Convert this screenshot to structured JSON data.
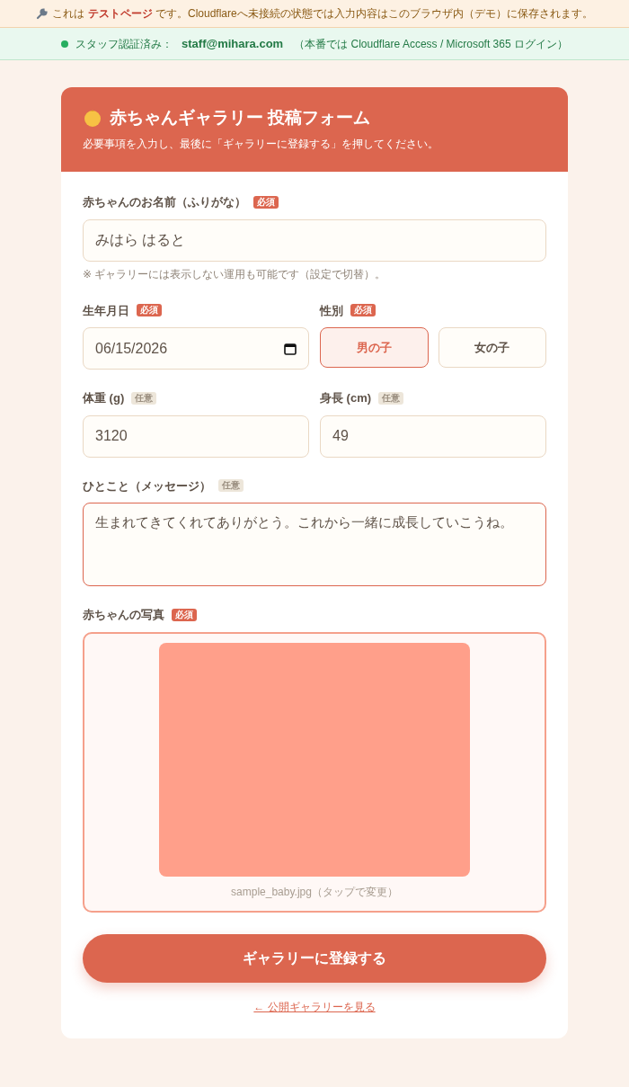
{
  "notice": {
    "text": "これは **テストページ** です。Cloudflareへ未接続の状態では入力内容はこのブラウザ内（デモ）に保存されます。"
  },
  "auth": {
    "color": "#27ae60",
    "label": "スタッフ認証済み：",
    "email": "staff@mihara.com",
    "note": "（本番では Cloudflare Access / Microsoft 365 ログイン）"
  },
  "form": {
    "title": "赤ちゃんギャラリー 投稿フォーム",
    "subtitle": "必要事項を入力し、最後に「ギャラリーに登録する」を押してください。",
    "fields": [
      {
        "kind": "text",
        "label": "赤ちゃんのお名前（ふりがな）",
        "badge": {
          "text": "必須",
          "required": true
        },
        "value": "みはら はると",
        "hint": "※ ギャラリーには表示しない運用も可能です（設定で切替）。"
      },
      {
        "kind": "row",
        "items": [
          {
            "kind": "date",
            "label": "生年月日",
            "badge": {
              "text": "必須",
              "required": true
            },
            "value": "06/15/2026"
          },
          {
            "kind": "choice",
            "label": "性別",
            "badge": {
              "text": "必須",
              "required": true
            },
            "options": [
              {
                "label": "男の子",
                "selected": true
              },
              {
                "label": "女の子",
                "selected": false
              }
            ]
          }
        ]
      },
      {
        "kind": "row",
        "items": [
          {
            "kind": "text",
            "label": "体重 (g)",
            "badge": {
              "text": "任意",
              "required": false
            },
            "value": "3120"
          },
          {
            "kind": "text",
            "label": "身長 (cm)",
            "badge": {
              "text": "任意",
              "required": false
            },
            "value": "49"
          }
        ]
      },
      {
        "kind": "textarea",
        "label": "ひとこと（メッセージ）",
        "badge": {
          "text": "任意",
          "required": false
        },
        "value": "生まれてきてくれてありがとう。これから一緒に成長していこうね。",
        "focused": true
      },
      {
        "kind": "photo",
        "label": "赤ちゃんの写真",
        "badge": {
          "text": "必須",
          "required": true
        },
        "filename": "sample_baby.jpg（タップで変更）"
      }
    ],
    "submit": "ギャラリーに登録する",
    "back_link": "← 公開ギャラリーを見る"
  }
}
